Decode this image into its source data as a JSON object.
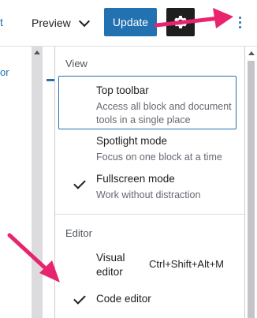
{
  "toolbar": {
    "edge_text": "t",
    "preview_label": "Preview",
    "update_label": "Update"
  },
  "left": {
    "edge_text": "or"
  },
  "menu": {
    "view_heading": "View",
    "editor_heading": "Editor",
    "items": [
      {
        "title": "Top toolbar",
        "description": "Access all block and document tools in a single place",
        "checked": false,
        "focused": true
      },
      {
        "title": "Spotlight mode",
        "description": "Focus on one block at a time",
        "checked": false
      },
      {
        "title": "Fullscreen mode",
        "description": "Work without distraction",
        "checked": true
      }
    ],
    "editor_items": [
      {
        "title": "Visual editor",
        "shortcut": "Ctrl+Shift+Alt+M",
        "checked": false
      },
      {
        "title": "Code editor",
        "checked": true
      }
    ]
  },
  "colors": {
    "accent": "#2271b1",
    "annotation_arrow": "#e8246f",
    "settings_bg": "#1e1e1e"
  },
  "icons": {
    "settings": "gear-icon",
    "more": "kebab-icon",
    "preview_caret": "chevron-down-icon",
    "check": "check-icon"
  }
}
